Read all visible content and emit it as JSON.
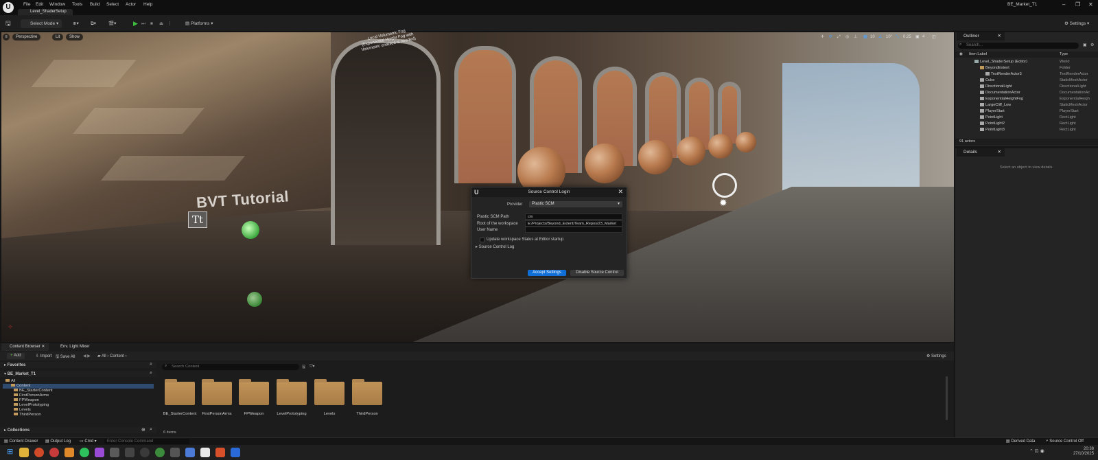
{
  "title_bar": {
    "menu": [
      "File",
      "Edit",
      "Window",
      "Tools",
      "Build",
      "Select",
      "Actor",
      "Help"
    ],
    "level_tab": "Level_ShaderSetup",
    "project_name": "BE_Market_T1"
  },
  "toolbar": {
    "select_mode": "Select Mode",
    "platforms": "Platforms",
    "settings": "Settings"
  },
  "viewport": {
    "perspective": "Perspective",
    "lit": "Lit",
    "show": "Show",
    "tool_values": [
      "10",
      "10°",
      "0.25",
      "4"
    ],
    "scene_text": "BVT Tutorial",
    "fog_text_lines": [
      "Local Volumetric Fog",
      "(Exponential Height Fog with",
      "Volumetric enabled is needed)"
    ]
  },
  "dialog": {
    "title": "Source Control Login",
    "provider_label": "Provider",
    "provider_value": "Plastic SCM",
    "scm_path_label": "Plastic SCM Path",
    "scm_path_value": "cm",
    "workspace_label": "Root of the workspace",
    "workspace_value": "E:/Projects/Beyond_Extent/Team_Repos/23_Market",
    "user_name_label": "User Name",
    "user_name_value": "",
    "update_checkbox_label": "Update workspace Status at Editor startup",
    "log_label": "Source Control Log",
    "accept_button": "Accept Settings",
    "disable_button": "Disable Source Control"
  },
  "outliner": {
    "tab": "Outliner",
    "search_placeholder": "Search...",
    "col_label": "Item Label",
    "col_type": "Type",
    "rows": [
      {
        "name": "Level_ShaderSetup (Editor)",
        "type": "World"
      },
      {
        "name": "BeyondExtent",
        "type": "Folder"
      },
      {
        "name": "TextRenderActor3",
        "type": "TextRenderActor"
      },
      {
        "name": "Cube",
        "type": "StaticMeshActor"
      },
      {
        "name": "DirectionalLight",
        "type": "DirectionalLight"
      },
      {
        "name": "DocumentationActor",
        "type": "DocumentationAc"
      },
      {
        "name": "ExponentialHeightFog",
        "type": "ExponentialHeigh"
      },
      {
        "name": "LargeCliff_Low",
        "type": "StaticMeshActor"
      },
      {
        "name": "PlayerStart",
        "type": "PlayerStart"
      },
      {
        "name": "PointLight",
        "type": "RectLight"
      },
      {
        "name": "PointLight2",
        "type": "RectLight"
      },
      {
        "name": "PointLight3",
        "type": "RectLight"
      }
    ],
    "actor_count": "91 actors"
  },
  "details": {
    "tab": "Details",
    "empty_text": "Select an object to view details."
  },
  "content_browser": {
    "tab": "Content Browser",
    "tab2": "Env. Light Mixer",
    "add": "Add",
    "import": "Import",
    "save_all": "Save All",
    "breadcrumb_all": "All",
    "breadcrumb_content": "Content",
    "settings": "Settings",
    "favorites": "Favorites",
    "project": "BE_Market_T1",
    "search_placeholder": "Search Content",
    "tree": [
      "All",
      "Content",
      "BE_StarterContent",
      "FirstPersonArms",
      "FPWeapon",
      "LevelPrototyping",
      "Levels",
      "ThirdPerson"
    ],
    "folders": [
      "BE_StarterContent",
      "FirstPersonArms",
      "FPWeapon",
      "LevelPrototyping",
      "Levels",
      "ThirdPerson"
    ],
    "item_count": "6 items",
    "collections": "Collections"
  },
  "status_bar": {
    "content_drawer": "Content Drawer",
    "output_log": "Output Log",
    "cmd": "Cmd",
    "console_placeholder": "Enter Console Command",
    "derived_data": "Derived Data",
    "source_control": "Source Control Off",
    "time": "20:38",
    "date": "27/10/2025"
  }
}
